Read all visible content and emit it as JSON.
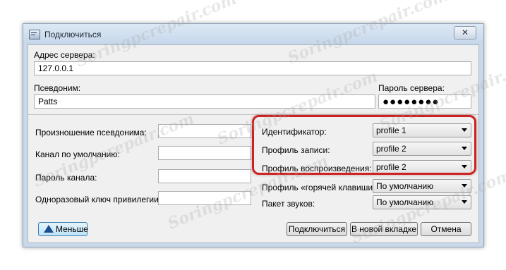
{
  "dialog": {
    "title": "Подключиться",
    "close_glyph": "✕",
    "server_address": {
      "label": "Адрес сервера:",
      "value": "127.0.0.1"
    },
    "nickname": {
      "label": "Псевдоним:",
      "value": "Patts"
    },
    "server_password": {
      "label": "Пароль сервера:",
      "value": "●●●●●●●●"
    },
    "left_fields": [
      {
        "label": "Произношение псевдонима:",
        "value": ""
      },
      {
        "label": "Канал по умолчанию:",
        "value": ""
      },
      {
        "label": "Пароль канала:",
        "value": ""
      },
      {
        "label": "Одноразовый ключ привилегии:",
        "value": ""
      }
    ],
    "right_fields": [
      {
        "label": "Идентификатор:",
        "value": "profile 1"
      },
      {
        "label": "Профиль записи:",
        "value": "profile 2"
      },
      {
        "label": "Профиль воспроизведения:",
        "value": "profile 2"
      },
      {
        "label": "Профиль «горячей клавиши»:",
        "value": "По умолчанию"
      },
      {
        "label": "Пакет звуков:",
        "value": "По умолчанию"
      }
    ],
    "buttons": {
      "less": "Меньше",
      "connect": "Подключиться",
      "new_tab": "В новой вкладке",
      "cancel": "Отмена"
    }
  },
  "watermark": "Soringpcrepair.com",
  "colors": {
    "highlight": "#cc2222",
    "title_bar": "#c9d9ea"
  }
}
